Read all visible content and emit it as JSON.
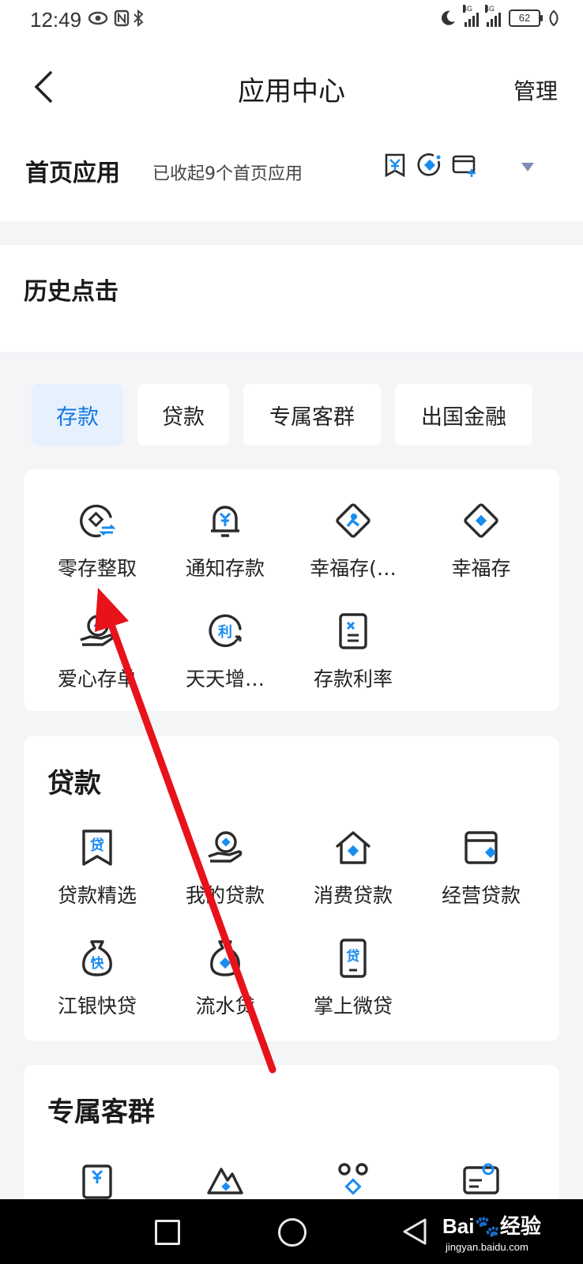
{
  "status_bar": {
    "time": "12:49",
    "battery": "62",
    "net1": "4G",
    "net2": "4G"
  },
  "nav": {
    "title": "应用中心",
    "manage": "管理"
  },
  "home_apps": {
    "title": "首页应用",
    "subtitle": "已收起9个首页应用"
  },
  "history": {
    "title": "历史点击"
  },
  "tabs": [
    {
      "label": "存款"
    },
    {
      "label": "贷款"
    },
    {
      "label": "专属客群"
    },
    {
      "label": "出国金融"
    }
  ],
  "deposit_apps": [
    {
      "label": "零存整取",
      "icon": "diamond-transfer-icon"
    },
    {
      "label": "通知存款",
      "icon": "bell-yuan-icon"
    },
    {
      "label": "幸福存(…",
      "icon": "diamond-person-icon"
    },
    {
      "label": "幸福存",
      "icon": "diamond-icon"
    },
    {
      "label": "爱心存单",
      "icon": "hand-coin-icon"
    },
    {
      "label": "天天增…",
      "icon": "interest-circle-icon"
    },
    {
      "label": "存款利率",
      "icon": "rate-document-icon"
    }
  ],
  "loan_section": {
    "title": "贷款",
    "apps": [
      {
        "label": "贷款精选",
        "icon": "loan-bookmark-icon"
      },
      {
        "label": "我的贷款",
        "icon": "hand-coin-icon"
      },
      {
        "label": "消费贷款",
        "icon": "house-icon"
      },
      {
        "label": "经营贷款",
        "icon": "shop-icon"
      },
      {
        "label": "江银快贷",
        "icon": "money-bag-fast-icon"
      },
      {
        "label": "流水贷",
        "icon": "money-bag-icon"
      },
      {
        "label": "掌上微贷",
        "icon": "phone-loan-icon"
      }
    ]
  },
  "group_section": {
    "title": "专属客群"
  },
  "watermark": {
    "brand": "Bai",
    "brand_suffix": "经验",
    "url": "jingyan.baidu.com"
  },
  "colors": {
    "accent": "#1677e6",
    "icon_dark": "#2b2b2b",
    "icon_blue": "#1a8cf0",
    "annotation": "#e8121a"
  }
}
